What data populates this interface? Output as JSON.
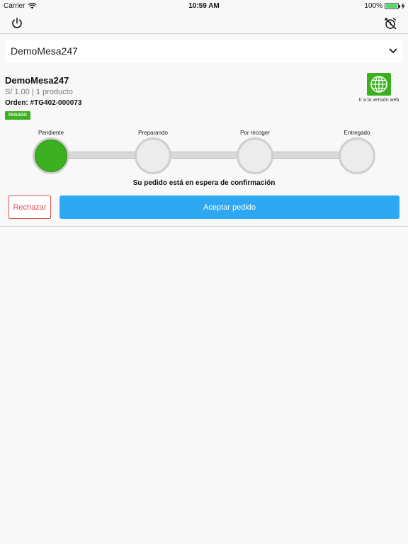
{
  "status_bar": {
    "carrier": "Carrier",
    "time": "10:59 AM",
    "battery": "100%",
    "battery_level": 1.0
  },
  "toolbar": {
    "left_icon": "power-icon",
    "right_icon": "alarm-off-icon"
  },
  "selector": {
    "value": "DemoMesa247",
    "icon": "chevron-down-icon"
  },
  "order": {
    "name": "DemoMesa247",
    "summary": "S/ 1.00 | 1 producto",
    "number": "Orden: #TG402-000073",
    "badge": "PAGADO",
    "web_label": "Ir a la versión web",
    "web_icon": "globe-icon"
  },
  "progress": {
    "steps": [
      {
        "label": "Pendiente",
        "active": true
      },
      {
        "label": "Preparando",
        "active": false
      },
      {
        "label": "Por recoger",
        "active": false
      },
      {
        "label": "Entregado",
        "active": false
      }
    ],
    "message": "Su pedido está en espera de confirmación"
  },
  "actions": {
    "reject_label": "Rechazar",
    "accept_label": "Aceptar pedido"
  },
  "colors": {
    "accent_blue": "#2ea8f0",
    "success_green": "#3cb021",
    "danger_red": "#d9534f"
  }
}
